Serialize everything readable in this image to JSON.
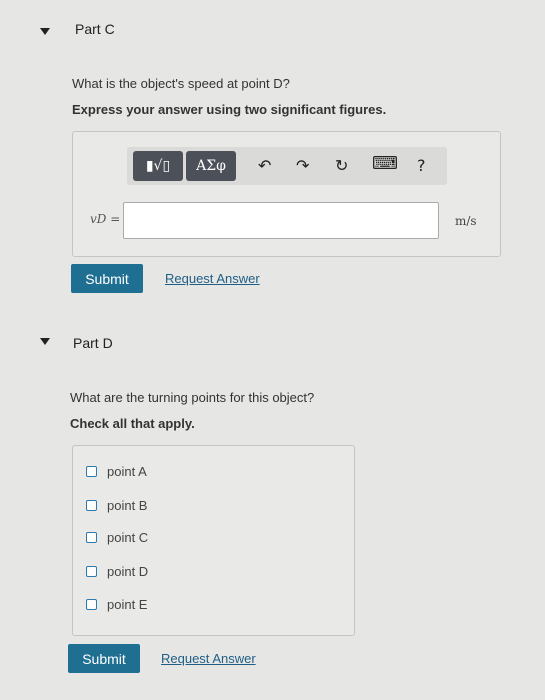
{
  "part_c": {
    "title": "Part C",
    "question": "What is the object's speed at point D?",
    "instruction": "Express your answer using two significant figures.",
    "toolbar": {
      "templates_label": "▮√▯",
      "symbols_label": "ΑΣφ",
      "undo_icon": "↶",
      "redo_icon": "↷",
      "reset_icon": "↻",
      "keyboard_icon": "⌨",
      "help_label": "?"
    },
    "variable_label": "vD =",
    "input_value": "",
    "unit": "m/s",
    "submit_label": "Submit",
    "request_label": "Request Answer"
  },
  "part_d": {
    "title": "Part D",
    "question": "What are the turning points for this object?",
    "instruction": "Check all that apply.",
    "options": [
      "point A",
      "point B",
      "point C",
      "point D",
      "point E"
    ],
    "submit_label": "Submit",
    "request_label": "Request Answer"
  }
}
